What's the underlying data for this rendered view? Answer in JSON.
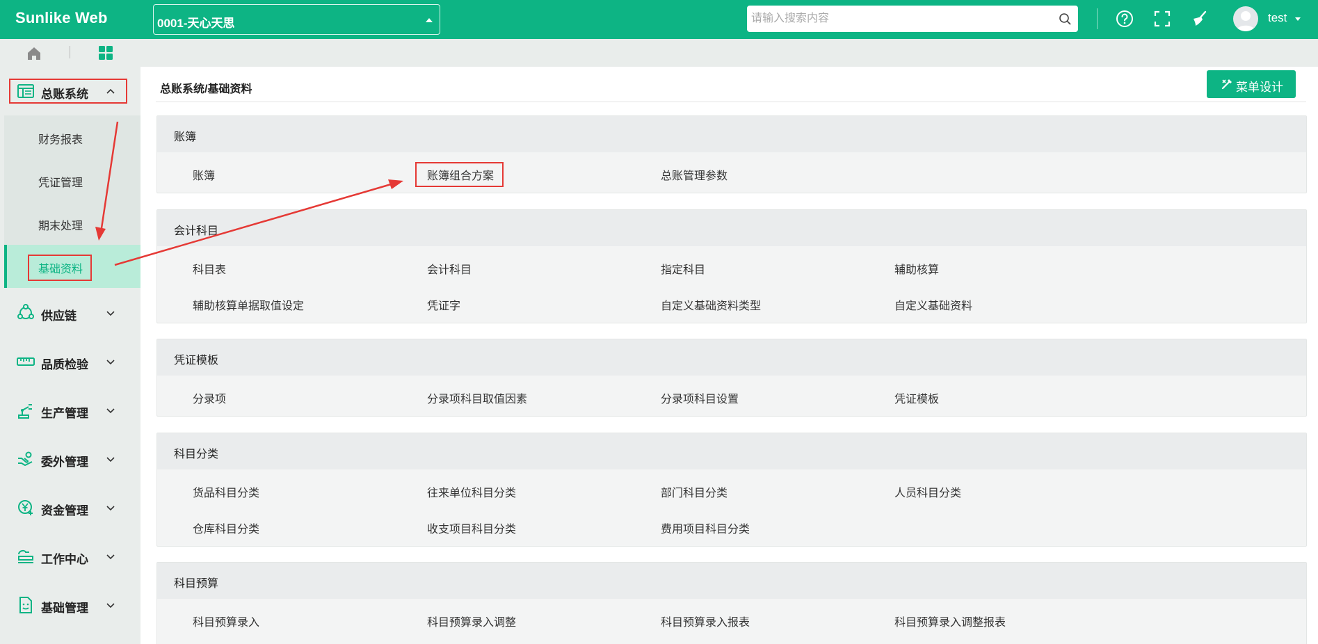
{
  "app": {
    "logo": "Sunlike Web"
  },
  "topbar": {
    "company": "0001-天心天思",
    "search_placeholder": "请输入搜索内容",
    "user": "test"
  },
  "sidebar": {
    "groups": [
      {
        "label": "总账系统",
        "icon": "ledger-icon",
        "expanded": true
      },
      {
        "label": "供应链",
        "icon": "supply-chain-icon"
      },
      {
        "label": "品质检验",
        "icon": "ruler-icon"
      },
      {
        "label": "生产管理",
        "icon": "robot-arm-icon"
      },
      {
        "label": "委外管理",
        "icon": "handshake-icon"
      },
      {
        "label": "资金管理",
        "icon": "yuan-coin-icon"
      },
      {
        "label": "工作中心",
        "icon": "workbench-icon"
      },
      {
        "label": "基础管理",
        "icon": "document-icon"
      }
    ],
    "sub_items": [
      "财务报表",
      "凭证管理",
      "期末处理",
      "基础资料"
    ],
    "active_sub": "基础资料"
  },
  "main": {
    "breadcrumb": "总账系统/基础资料",
    "design_button": "菜单设计",
    "accent": "#0db484",
    "panels": [
      {
        "title": "账簿",
        "rows": [
          [
            "账簿",
            "账簿组合方案",
            "总账管理参数"
          ]
        ]
      },
      {
        "title": "会计科目",
        "rows": [
          [
            "科目表",
            "会计科目",
            "指定科目",
            "辅助核算"
          ],
          [
            "辅助核算单据取值设定",
            "凭证字",
            "自定义基础资料类型",
            "自定义基础资料"
          ]
        ]
      },
      {
        "title": "凭证模板",
        "rows": [
          [
            "分录项",
            "分录项科目取值因素",
            "分录项科目设置",
            "凭证模板"
          ]
        ]
      },
      {
        "title": "科目分类",
        "rows": [
          [
            "货品科目分类",
            "往来单位科目分类",
            "部门科目分类",
            "人员科目分类"
          ],
          [
            "仓库科目分类",
            "收支项目科目分类",
            "费用项目科目分类"
          ]
        ]
      },
      {
        "title": "科目预算",
        "rows": [
          [
            "科目预算录入",
            "科目预算录入调整",
            "科目预算录入报表",
            "科目预算录入调整报表"
          ]
        ]
      }
    ]
  }
}
